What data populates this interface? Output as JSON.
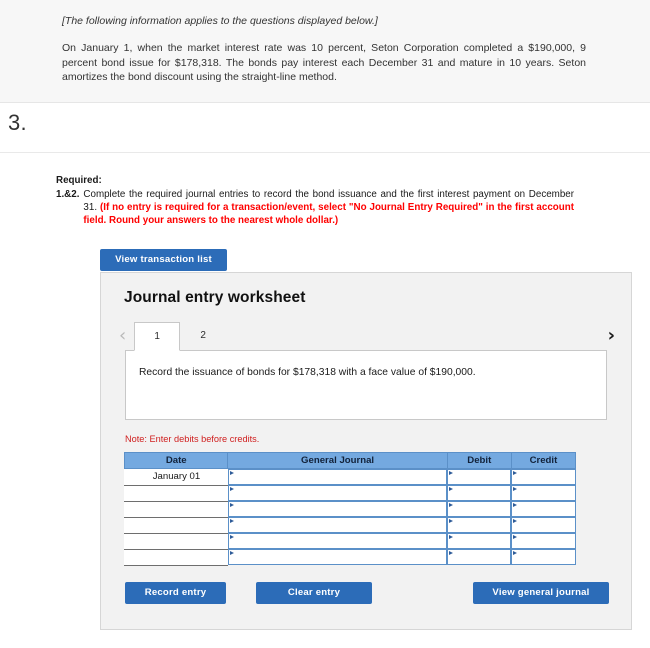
{
  "info": {
    "applies_note": "[The following information applies to the questions displayed below.]",
    "scenario": "On January 1, when the market interest rate was 10 percent, Seton Corporation completed a $190,000, 9 percent bond issue for $178,318. The bonds pay interest each December 31 and mature in 10 years. Seton amortizes the bond discount using the straight-line method."
  },
  "question": {
    "number": "3."
  },
  "required": {
    "label": "Required:",
    "item_number": "1.&2.",
    "black_text": "Complete the required journal entries to record the bond issuance and the first interest payment on December 31. ",
    "red_text": "(If no entry is required for a transaction/event, select \"No Journal Entry Required\" in the first account field. Round your answers to the nearest whole dollar.)"
  },
  "toolbar": {
    "view_transaction_list": "View transaction list"
  },
  "worksheet": {
    "title": "Journal entry worksheet",
    "prev_arrow": "‹",
    "next_arrow": "›",
    "tabs": [
      {
        "label": "1",
        "active": true
      },
      {
        "label": "2",
        "active": false
      }
    ],
    "description": "Record the issuance of bonds for $178,318 with a face value of $190,000.",
    "note": "Note: Enter debits before credits."
  },
  "table": {
    "headers": [
      "Date",
      "General Journal",
      "Debit",
      "Credit"
    ],
    "rows": [
      {
        "date": "January 01",
        "general_journal": "",
        "debit": "",
        "credit": ""
      },
      {
        "date": "",
        "general_journal": "",
        "debit": "",
        "credit": ""
      },
      {
        "date": "",
        "general_journal": "",
        "debit": "",
        "credit": ""
      },
      {
        "date": "",
        "general_journal": "",
        "debit": "",
        "credit": ""
      },
      {
        "date": "",
        "general_journal": "",
        "debit": "",
        "credit": ""
      },
      {
        "date": "",
        "general_journal": "",
        "debit": "",
        "credit": ""
      }
    ]
  },
  "footer": {
    "record_entry": "Record entry",
    "clear_entry": "Clear entry",
    "view_general_journal": "View general journal"
  },
  "colors": {
    "accent_blue": "#2c6cb8",
    "table_header_blue": "#74a9e0",
    "input_border_blue": "#5b90c8",
    "alert_red": "#ff0000",
    "note_red": "#d02020",
    "panel_bg": "#f2f2f2",
    "info_bg": "#f7f7f7"
  }
}
